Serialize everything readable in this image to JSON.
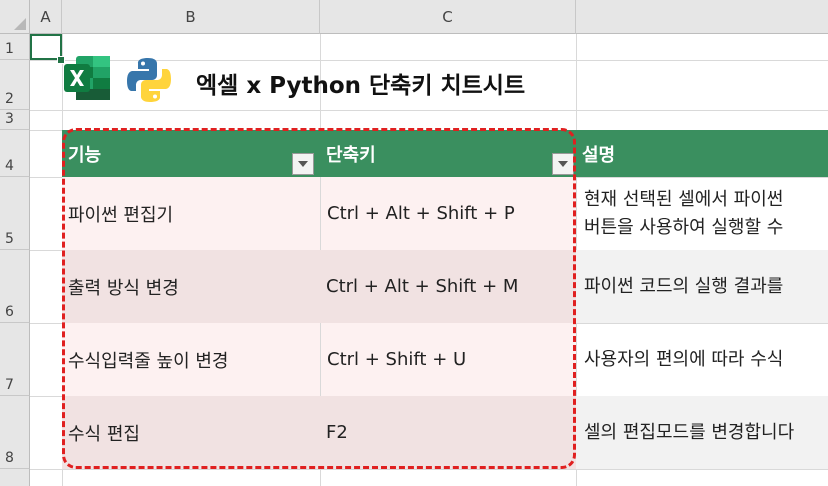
{
  "column_headers": [
    "A",
    "B",
    "C"
  ],
  "row_headers": [
    "1",
    "2",
    "3",
    "4",
    "5",
    "6",
    "7",
    "8"
  ],
  "sheet": {
    "title": "엑셀 x Python 단축키 치트시트",
    "table_headers": [
      "기능",
      "단축키",
      "설명"
    ],
    "rows": [
      {
        "feature": "파이썬 편집기",
        "shortcut": "Ctrl + Alt + Shift + P",
        "desc1": "현재 선택된 셀에서 파이썬",
        "desc2": "버튼을 사용하여 실행할 수"
      },
      {
        "feature": "출력 방식 변경",
        "shortcut": "Ctrl + Alt + Shift + M",
        "desc1": "파이썬 코드의 실행 결과를",
        "desc2": ""
      },
      {
        "feature": "수식입력줄 높이 변경",
        "shortcut": "Ctrl + Shift + U",
        "desc1": "사용자의 편의에 따라 수식",
        "desc2": ""
      },
      {
        "feature": "수식 편집",
        "shortcut": "F2",
        "desc1": "셀의 편집모드를 변경합니다",
        "desc2": ""
      }
    ]
  },
  "colors": {
    "header_green": "#3a8f5f",
    "row_light": "#fdf1f1",
    "row_dark": "#f1e2e2",
    "highlight_border": "#e02020",
    "selection": "#217346"
  }
}
